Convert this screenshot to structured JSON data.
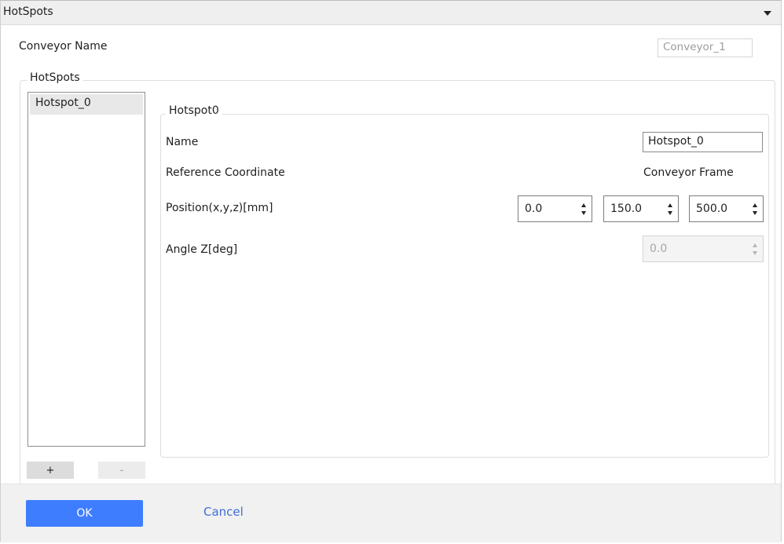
{
  "window": {
    "title": "HotSpots"
  },
  "conveyor": {
    "label": "Conveyor Name",
    "value": "Conveyor_1"
  },
  "hotspots_group": {
    "title": "HotSpots",
    "list": [
      "Hotspot_0"
    ],
    "add_label": "+",
    "remove_label": "-"
  },
  "hotspot_detail": {
    "title": "Hotspot0",
    "name_label": "Name",
    "name_value": "Hotspot_0",
    "refcoord_label": "Reference Coordinate",
    "refcoord_value": "Conveyor Frame",
    "position_label": "Position(x,y,z)[mm]",
    "position_x": "0.0",
    "position_y": "150.0",
    "position_z": "500.0",
    "angle_label": "Angle Z[deg]",
    "angle_value": "0.0"
  },
  "footer": {
    "ok_label": "OK",
    "cancel_label": "Cancel"
  },
  "colors": {
    "accent": "#3f7dff",
    "link": "#3f6fd8"
  }
}
